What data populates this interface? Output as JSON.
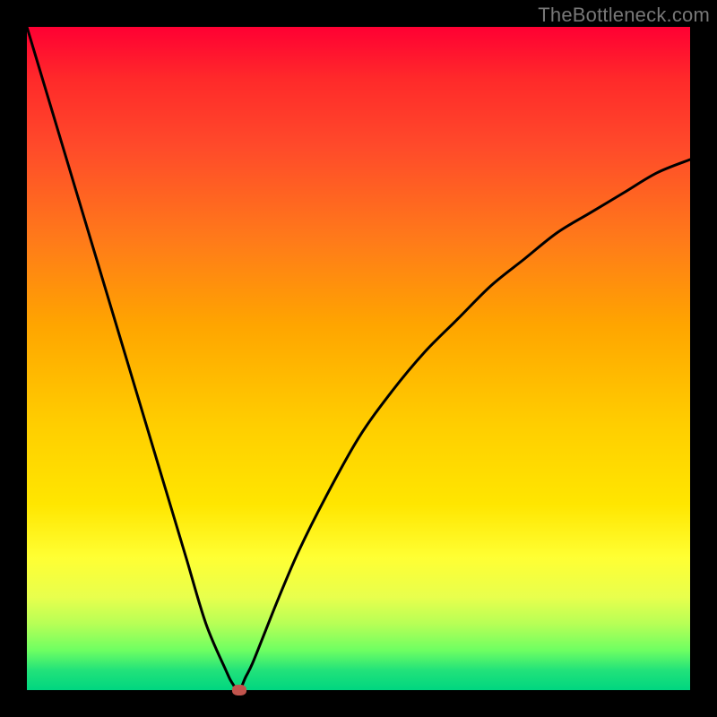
{
  "watermark": {
    "text": "TheBottleneck.com"
  },
  "chart_data": {
    "type": "line",
    "title": "",
    "xlabel": "",
    "ylabel": "",
    "xlim": [
      0,
      100
    ],
    "ylim": [
      0,
      100
    ],
    "grid": false,
    "legend": false,
    "background_gradient": {
      "direction": "vertical",
      "top": "#ff0033",
      "bottom": "#00d680"
    },
    "series": [
      {
        "name": "bottleneck-curve",
        "x": [
          0,
          3,
          6,
          9,
          12,
          15,
          18,
          21,
          24,
          27,
          30,
          31,
          32,
          33,
          34,
          36,
          38,
          41,
          45,
          50,
          55,
          60,
          65,
          70,
          75,
          80,
          85,
          90,
          95,
          100
        ],
        "values": [
          100,
          90,
          80,
          70,
          60,
          50,
          40,
          30,
          20,
          10,
          3,
          1,
          0,
          2,
          4,
          9,
          14,
          21,
          29,
          38,
          45,
          51,
          56,
          61,
          65,
          69,
          72,
          75,
          78,
          80
        ]
      }
    ],
    "marker": {
      "x": 32,
      "y": 0,
      "color": "#c1544d"
    }
  }
}
